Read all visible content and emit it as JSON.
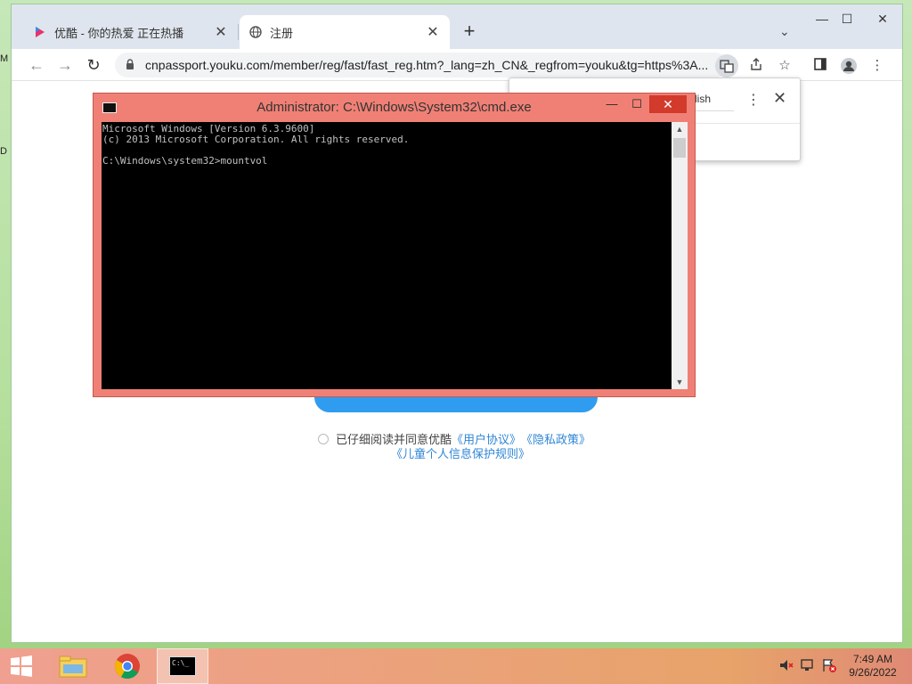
{
  "desktop": {
    "left_char_top": "M",
    "left_char_mid": "D"
  },
  "browser": {
    "tabs": [
      {
        "title": "优酷 - 你的热爱 正在热播",
        "close": "✕"
      },
      {
        "title": "注册",
        "close": "✕"
      }
    ],
    "new_tab": "+",
    "tab_search": "⌄",
    "window_controls": {
      "minimize": "—",
      "maximize": "☐",
      "close": "✕"
    },
    "nav": {
      "back": "←",
      "forward": "→",
      "reload": "↻"
    },
    "url": "cnpassport.youku.com/member/reg/fast/fast_reg.htm?_lang=zh_CN&_regfrom=youku&tg=https%3A...",
    "translate_popup": {
      "language_label": "lish",
      "more": "⋮",
      "close": "✕"
    }
  },
  "page": {
    "agree_text": "已仔细阅读并同意优酷",
    "links": {
      "user_agreement": "《用户协议》",
      "privacy_policy": "《隐私政策》",
      "child_rules": "《儿童个人信息保护规则》"
    }
  },
  "cmd": {
    "title": "Administrator: C:\\Windows\\System32\\cmd.exe",
    "controls": {
      "minimize": "—",
      "maximize": "☐",
      "close": "✕"
    },
    "output": "Microsoft Windows [Version 6.3.9600]\n(c) 2013 Microsoft Corporation. All rights reserved.\n\nC:\\Windows\\system32>mountvol"
  },
  "taskbar": {
    "clock_time": "7:49 AM",
    "clock_date": "9/26/2022",
    "cmd_icon_text": "C:\\_"
  },
  "colors": {
    "cmd_frame": "#f08075",
    "taskbar": "#e7a36a",
    "link": "#2f86d6",
    "button": "#2f9cf0"
  }
}
